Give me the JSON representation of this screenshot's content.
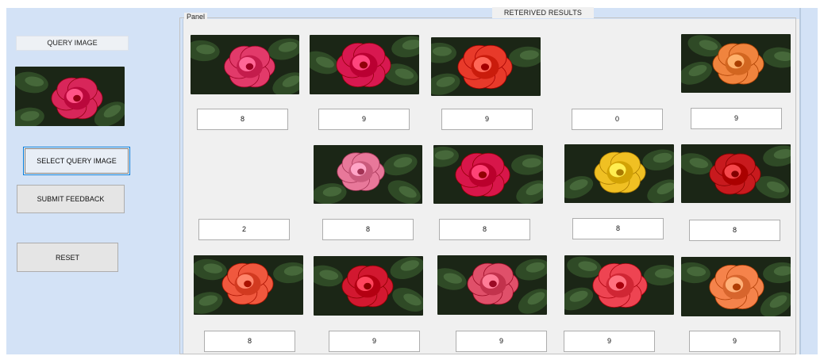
{
  "query": {
    "label": "QUERY IMAGE",
    "image_icon": "rose-photo-icon",
    "rose_color": "#d8265a"
  },
  "buttons": {
    "select_query_image": "SELECT QUERY IMAGE",
    "submit_feedback": "SUBMIT FEEDBACK",
    "reset": "RESET"
  },
  "panel": {
    "title": "Panel",
    "results_title": "RETERIVED RESULTS"
  },
  "results": [
    {
      "score": "8",
      "rose_color": "#e23a6a",
      "has_image": true
    },
    {
      "score": "9",
      "rose_color": "#d81850",
      "has_image": true
    },
    {
      "score": "9",
      "rose_color": "#e83a2a",
      "has_image": true
    },
    {
      "score": "0",
      "rose_color": "",
      "has_image": false
    },
    {
      "score": "9",
      "rose_color": "#f0843e",
      "has_image": true
    },
    {
      "score": "2",
      "rose_color": "",
      "has_image": false
    },
    {
      "score": "8",
      "rose_color": "#e8789a",
      "has_image": true
    },
    {
      "score": "8",
      "rose_color": "#d8164a",
      "has_image": true
    },
    {
      "score": "8",
      "rose_color": "#f0c023",
      "has_image": true
    },
    {
      "score": "8",
      "rose_color": "#c81a1e",
      "has_image": true
    },
    {
      "score": "8",
      "rose_color": "#f0583e",
      "has_image": true
    },
    {
      "score": "9",
      "rose_color": "#d21830",
      "has_image": true
    },
    {
      "score": "9",
      "rose_color": "#e0506a",
      "has_image": true
    },
    {
      "score": "9",
      "rose_color": "#ee4452",
      "has_image": true
    },
    {
      "score": "9",
      "rose_color": "#f5834b",
      "has_image": true
    }
  ]
}
